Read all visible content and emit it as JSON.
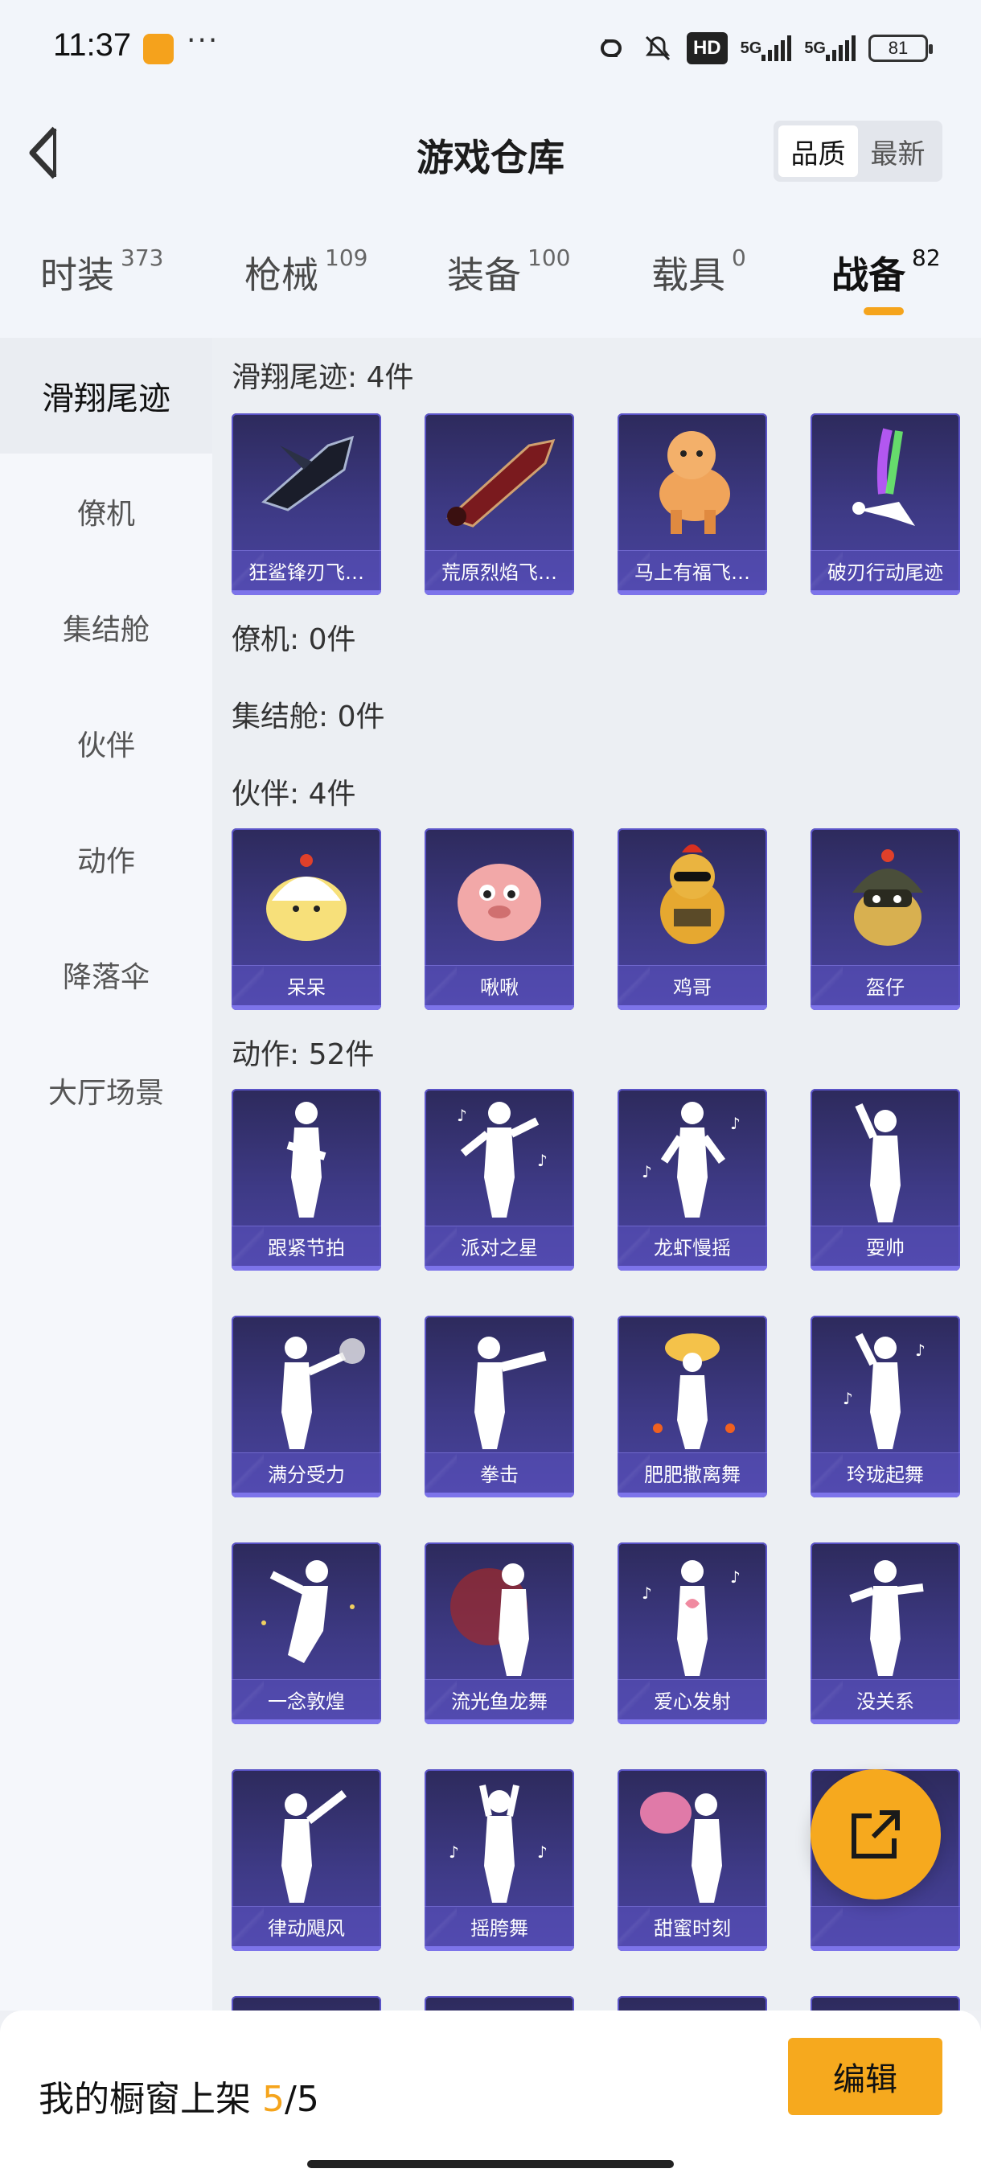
{
  "status_bar": {
    "time": "11:37",
    "dots": "···",
    "hd": "HD",
    "net1": "5G",
    "net2": "5G",
    "battery": "81"
  },
  "header": {
    "title": "游戏仓库",
    "sort_options": [
      "品质",
      "最新"
    ]
  },
  "category_tabs": [
    {
      "name": "时装",
      "count": "373"
    },
    {
      "name": "枪械",
      "count": "109"
    },
    {
      "name": "装备",
      "count": "100"
    },
    {
      "name": "载具",
      "count": "0"
    },
    {
      "name": "战备",
      "count": "82"
    }
  ],
  "sidebar": {
    "items": [
      "滑翔尾迹",
      "僚机",
      "集结舱",
      "伙伴",
      "动作",
      "降落伞",
      "大厅场景"
    ]
  },
  "sections": {
    "glide": {
      "title": "滑翔尾迹: 4件",
      "items": [
        "狂鲨锋刃飞…",
        "荒原烈焰飞…",
        "马上有福飞…",
        "破刃行动尾迹"
      ]
    },
    "wingman": {
      "title": "僚机: 0件"
    },
    "capsule": {
      "title": "集结舱: 0件"
    },
    "partner": {
      "title": "伙伴: 4件",
      "items": [
        "呆呆",
        "啾啾",
        "鸡哥",
        "盔仔"
      ]
    },
    "action": {
      "title": "动作: 52件",
      "items": [
        "跟紧节拍",
        "派对之星",
        "龙虾慢摇",
        "耍帅",
        "满分受力",
        "拳击",
        "肥肥撒离舞",
        "玲珑起舞",
        "一念敦煌",
        "流光鱼龙舞",
        "爱心发射",
        "没关系",
        "律动飓风",
        "摇胯舞",
        "甜蜜时刻",
        ""
      ]
    }
  },
  "bottom": {
    "label": "我的橱窗上架 ",
    "count": "5",
    "total": "/5",
    "edit_label": "编辑"
  },
  "colors": {
    "accent": "#f6a91e",
    "card": "#3e3a86"
  }
}
